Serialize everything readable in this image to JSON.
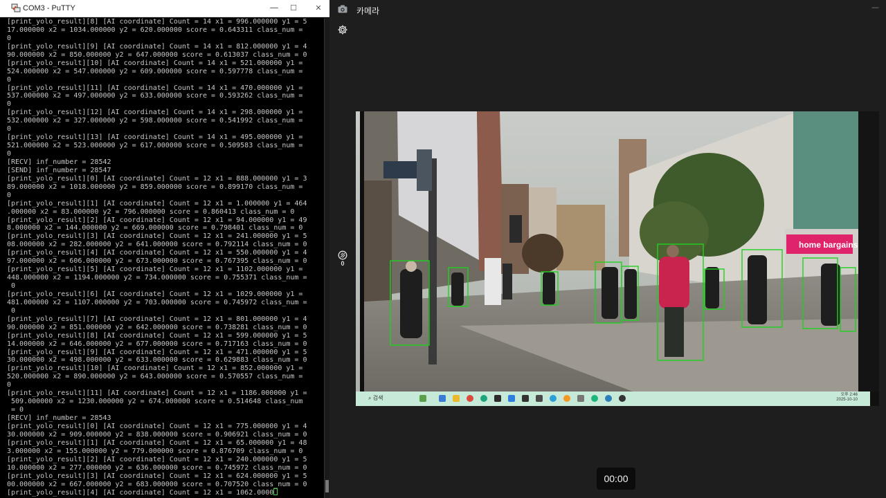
{
  "putty": {
    "title": "COM3 - PuTTY",
    "controls": {
      "minimize": "—",
      "maximize": "☐",
      "close": "✕"
    },
    "lines": [
      "[print_yolo_result][8] [AI coordinate] Count = 14 x1 = 996.000000 y1 = 5",
      "17.000000 x2 = 1034.000000 y2 = 620.000000 score = 0.643311 class_num =",
      "0",
      "[print_yolo_result][9] [AI coordinate] Count = 14 x1 = 812.000000 y1 = 4",
      "90.000000 x2 = 850.000000 y2 = 647.000000 score = 0.613037 class_num = 0",
      "[print_yolo_result][10] [AI coordinate] Count = 14 x1 = 521.000000 y1 =",
      "524.000000 x2 = 547.000000 y2 = 609.000000 score = 0.597778 class_num =",
      "0",
      "[print_yolo_result][11] [AI coordinate] Count = 14 x1 = 470.000000 y1 =",
      "537.000000 x2 = 497.000000 y2 = 633.000000 score = 0.593262 class_num =",
      "0",
      "[print_yolo_result][12] [AI coordinate] Count = 14 x1 = 298.000000 y1 =",
      "532.000000 x2 = 327.000000 y2 = 598.000000 score = 0.541992 class_num =",
      "0",
      "[print_yolo_result][13] [AI coordinate] Count = 14 x1 = 495.000000 y1 =",
      "521.000000 x2 = 523.000000 y2 = 617.000000 score = 0.509583 class_num =",
      "0",
      "[RECV] inf_number = 28542",
      "[SEND] inf_number = 28547",
      "[print_yolo_result][0] [AI coordinate] Count = 12 x1 = 888.000000 y1 = 3",
      "89.000000 x2 = 1018.000000 y2 = 859.000000 score = 0.899170 class_num =",
      "0",
      "[print_yolo_result][1] [AI coordinate] Count = 12 x1 = 1.000000 y1 = 464",
      ".000000 x2 = 83.000000 y2 = 796.000000 score = 0.860413 class_num = 0",
      "[print_yolo_result][2] [AI coordinate] Count = 12 x1 = 94.000000 y1 = 49",
      "8.000000 x2 = 144.000000 y2 = 669.000000 score = 0.798401 class_num = 0",
      "[print_yolo_result][3] [AI coordinate] Count = 12 x1 = 241.000000 y1 = 5",
      "08.000000 x2 = 282.000000 y2 = 641.000000 score = 0.792114 class_num = 0",
      "[print_yolo_result][4] [AI coordinate] Count = 12 x1 = 550.000000 y1 = 4",
      "97.000000 x2 = 606.000000 y2 = 673.000000 score = 0.767395 class_num = 0",
      "[print_yolo_result][5] [AI coordinate] Count = 12 x1 = 1102.000000 y1 =",
      "448.000000 x2 = 1194.000000 y2 = 734.000000 score = 0.755371 class_num =",
      " 0",
      "[print_yolo_result][6] [AI coordinate] Count = 12 x1 = 1029.000000 y1 =",
      "481.000000 x2 = 1107.000000 y2 = 703.000000 score = 0.745972 class_num =",
      " 0",
      "[print_yolo_result][7] [AI coordinate] Count = 12 x1 = 801.000000 y1 = 4",
      "90.000000 x2 = 851.000000 y2 = 642.000000 score = 0.738281 class_num = 0",
      "[print_yolo_result][8] [AI coordinate] Count = 12 x1 = 599.000000 y1 = 5",
      "14.000000 x2 = 646.000000 y2 = 677.000000 score = 0.717163 class_num = 0",
      "[print_yolo_result][9] [AI coordinate] Count = 12 x1 = 471.000000 y1 = 5",
      "30.000000 x2 = 498.000000 y2 = 633.000000 score = 0.629883 class_num = 0",
      "[print_yolo_result][10] [AI coordinate] Count = 12 x1 = 852.000000 y1 =",
      "520.000000 x2 = 890.000000 y2 = 643.000000 score = 0.570557 class_num =",
      "0",
      "[print_yolo_result][11] [AI coordinate] Count = 12 x1 = 1186.000000 y1 =",
      " 509.000000 x2 = 1230.000000 y2 = 674.000000 score = 0.514648 class_num",
      " = 0",
      "[RECV] inf_number = 28543",
      "[print_yolo_result][0] [AI coordinate] Count = 12 x1 = 775.000000 y1 = 4",
      "30.000000 x2 = 909.000000 y2 = 838.000000 score = 0.906921 class_num = 0",
      "[print_yolo_result][1] [AI coordinate] Count = 12 x1 = 65.000000 y1 = 48",
      "3.000000 x2 = 155.000000 y2 = 779.000000 score = 0.876709 class_num = 0",
      "[print_yolo_result][2] [AI coordinate] Count = 12 x1 = 240.000000 y1 = 5",
      "10.000000 x2 = 277.000000 y2 = 636.000000 score = 0.745972 class_num = 0",
      "[print_yolo_result][3] [AI coordinate] Count = 12 x1 = 624.000000 y1 = 5",
      "00.000000 x2 = 667.000000 y2 = 683.000000 score = 0.707520 class_num = 0",
      "[print_yolo_result][4] [AI coordinate] Count = 12 x1 = 1062.0000"
    ]
  },
  "camera": {
    "title": "카메라",
    "zoom_value": "0",
    "timer": "00:00",
    "taskbar": {
      "search_placeholder": "검색",
      "time": "오후 2:46",
      "date": "2025-10-10"
    },
    "colors": {
      "detection_box": "#1fd11f",
      "taskbar": "#c7ead8",
      "accent": "#e0246b"
    }
  }
}
